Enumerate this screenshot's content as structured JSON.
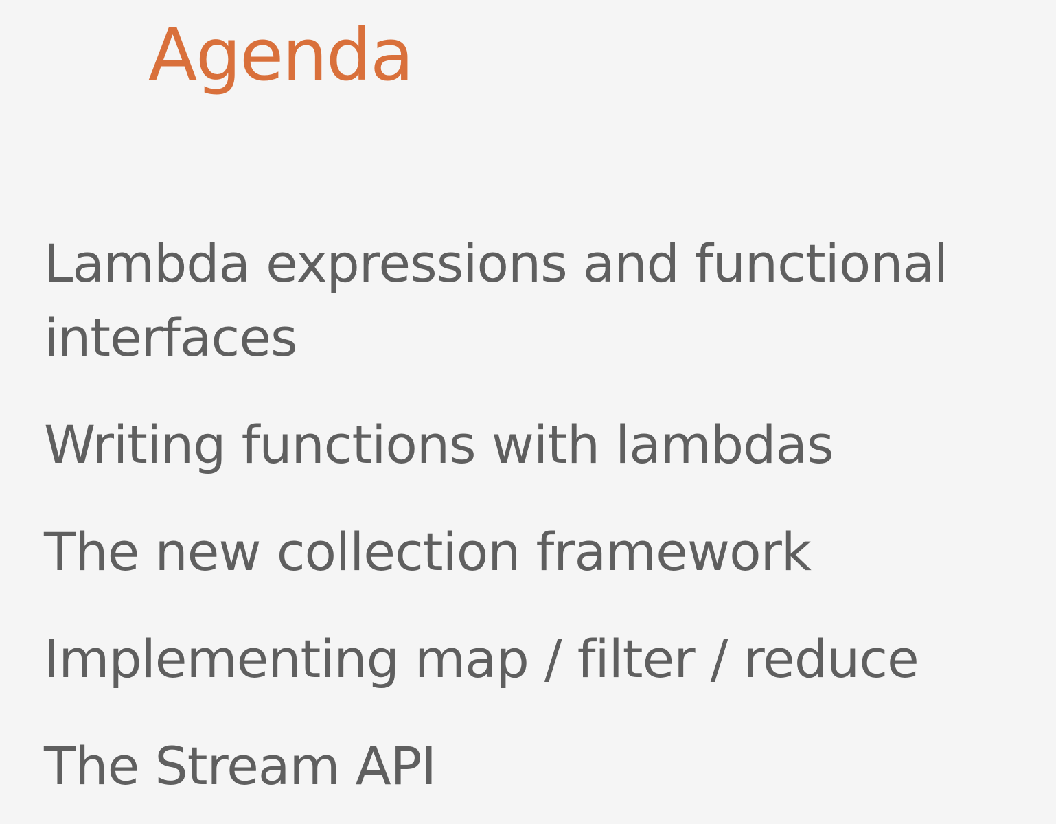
{
  "slide": {
    "title": "Agenda",
    "title_color": "#d9703b",
    "text_color": "#5f5f5f",
    "background_color": "#f5f5f5",
    "items": [
      {
        "line1": "Lambda expressions and functional",
        "line2": "interfaces"
      },
      {
        "line1": "Writing functions with lambdas"
      },
      {
        "line1": "The new collection framework"
      },
      {
        "line1": "Implementing map / filter / reduce"
      },
      {
        "line1": "The Stream API"
      }
    ]
  }
}
